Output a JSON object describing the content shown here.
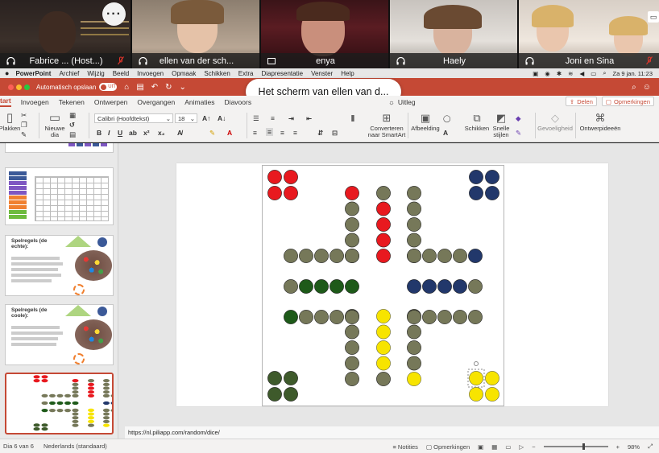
{
  "meeting": {
    "more_label": "···",
    "participants": [
      {
        "name": "Fabrice ... (Host...)",
        "left_icon": "headphones-icon",
        "muted": true
      },
      {
        "name": "ellen van der sch...",
        "left_icon": "headphones-icon",
        "muted": false
      },
      {
        "name": "enya",
        "left_icon": "screen-icon",
        "muted": false
      },
      {
        "name": "Haely",
        "left_icon": "headphones-icon",
        "muted": false
      },
      {
        "name": "Joni en Sina",
        "left_icon": "headphones-icon",
        "muted": true
      }
    ],
    "share_banner": "Het scherm van ellen van d..."
  },
  "menubar": {
    "app": "PowerPoint",
    "items": [
      "Archief",
      "Wijzig",
      "Beeld",
      "Invoegen",
      "Opmaak",
      "Schikken",
      "Extra",
      "Diapresentatie",
      "Venster",
      "Help"
    ],
    "datetime": "Za 9 jan. 11:23"
  },
  "titlebar": {
    "autosave_label": "Automatisch opslaan",
    "toggle_label": "UIT"
  },
  "ribbon": {
    "tabs": [
      "tart",
      "Invoegen",
      "Tekenen",
      "Ontwerpen",
      "Overgangen",
      "Animaties",
      "Diavoors",
      "Uitleg"
    ],
    "share_label": "Delen",
    "comments_label": "Opmerkingen",
    "paste_label": "Plakken",
    "new_slide_label": "Nieuwe dia",
    "font_name": "Calibri (Hoofdtekst)",
    "font_size": "18",
    "convert_label": "Converteren naar SmartArt",
    "picture_label": "Afbeelding",
    "arrange_label": "Schikken",
    "quick_styles_label": "Snelle stijlen",
    "sensitivity_label": "Gevoeligheid",
    "designer_label": "Ontwerpideeën"
  },
  "thumbnails": {
    "slide3_title": "Spelregels (de echte):",
    "slide4_title": "Spelregels (de coole):"
  },
  "notes": {
    "text": "https://nl.piliapp.com/random/dice/"
  },
  "statusbar": {
    "slide_info": "Dia 6 van 6",
    "language": "Nederlands (standaard)",
    "notes_label": "Notities",
    "comments_label": "Opmerkingen",
    "zoom": "98%"
  },
  "colors": {
    "accent": "#c54935",
    "red": "#e8191f",
    "blue": "#22386b",
    "green": "#1e5a19",
    "dark_green": "#3e5a2b",
    "yellow": "#f7e400",
    "gray": "#767859"
  }
}
